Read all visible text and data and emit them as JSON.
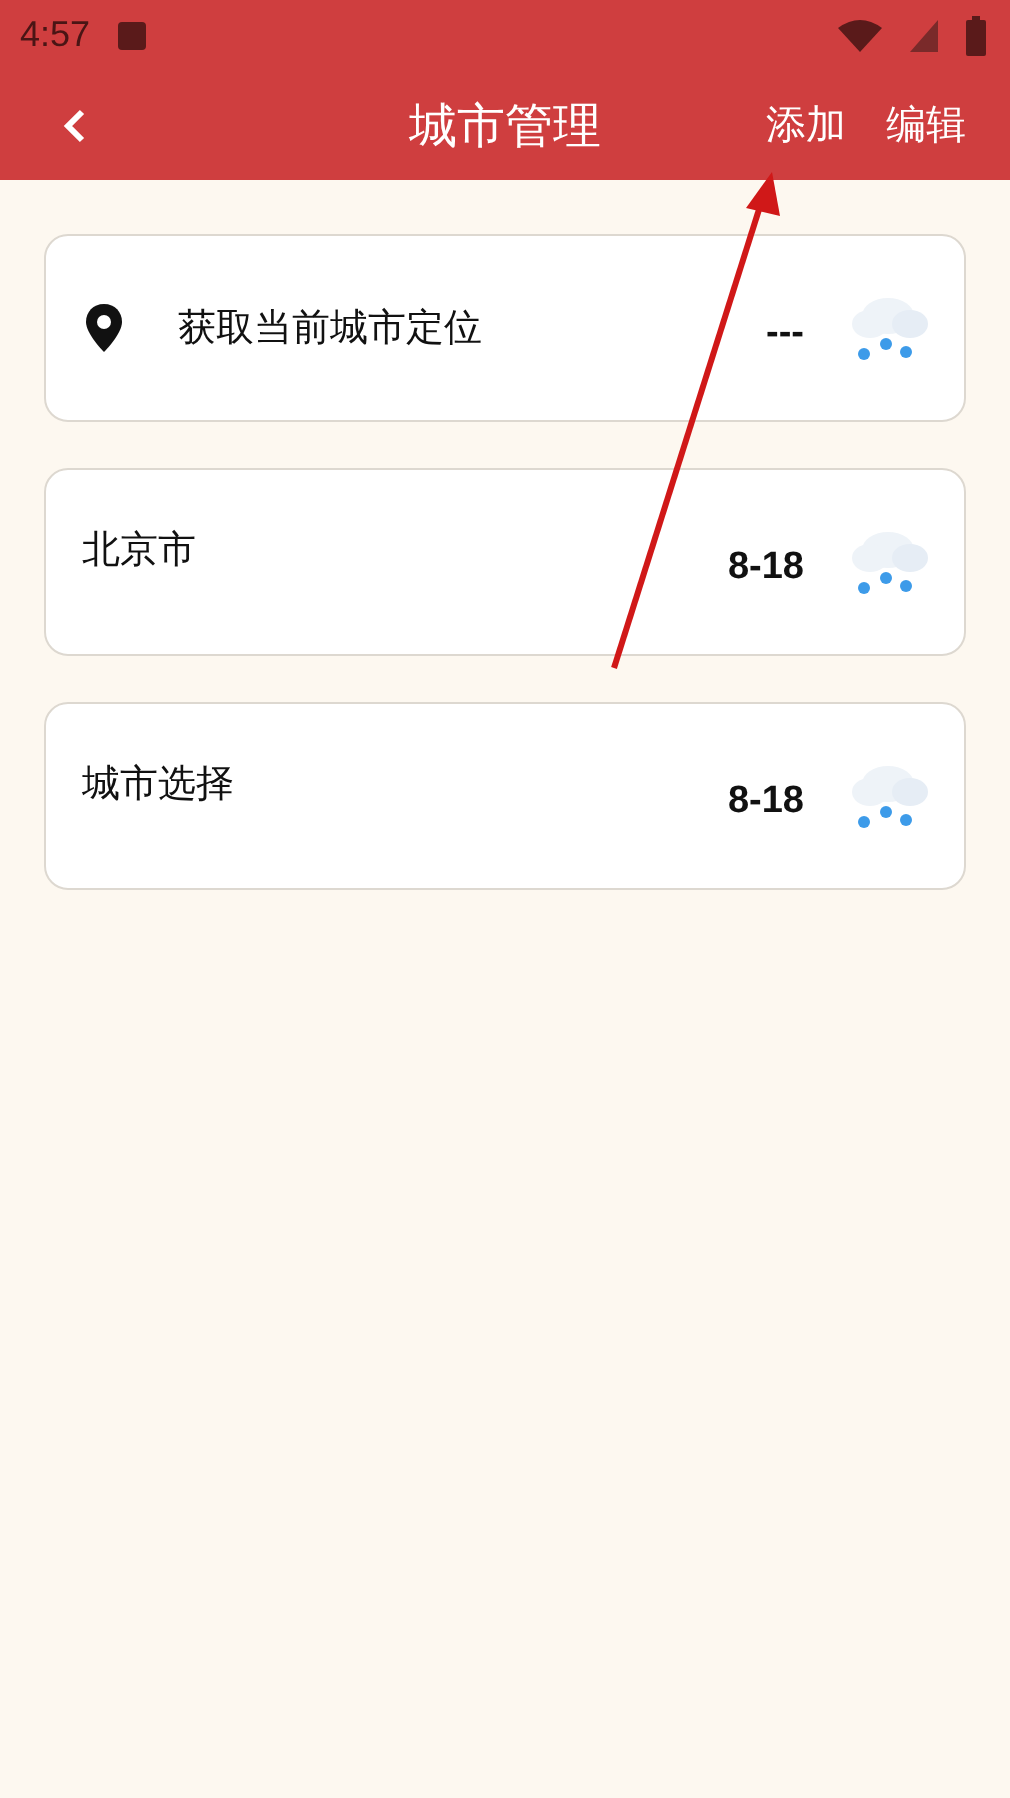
{
  "status_bar": {
    "time": "4:57"
  },
  "toolbar": {
    "title": "城市管理",
    "actions": [
      "添加",
      "编辑"
    ]
  },
  "cities": [
    {
      "kind": "location",
      "name": "获取当前城市定位",
      "temp": "---"
    },
    {
      "kind": "city",
      "name": "北京市",
      "temp": "8-18"
    },
    {
      "kind": "city",
      "name": "城市选择",
      "temp": "8-18"
    }
  ]
}
